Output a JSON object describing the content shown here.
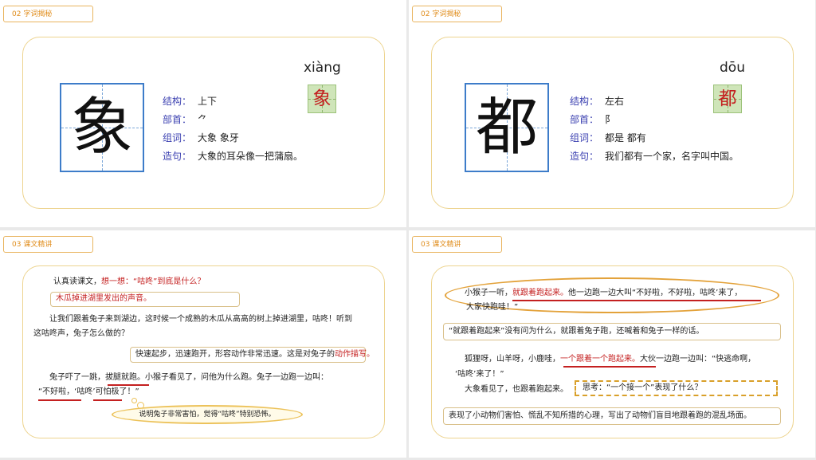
{
  "slides": [
    {
      "tag": "02  字词揭秘",
      "character": "象",
      "pinyin": "xiàng",
      "rows": [
        {
          "k": "结构：",
          "v": "上下"
        },
        {
          "k": "部首：",
          "v": "⺈"
        },
        {
          "k": "组词：",
          "v": "大象   象牙"
        },
        {
          "k": "造句：",
          "v": "大象的耳朵像一把蒲扇。"
        }
      ]
    },
    {
      "tag": "02  字词揭秘",
      "character": "都",
      "pinyin": "dōu",
      "rows": [
        {
          "k": "结构：",
          "v": "左右"
        },
        {
          "k": "部首：",
          "v": "阝"
        },
        {
          "k": "组词：",
          "v": "都是   都有"
        },
        {
          "k": "造句：",
          "v": "我们都有一个家，名字叫中国。"
        }
      ]
    },
    {
      "tag": "03  课文精讲",
      "l1a": "认真读课文，",
      "l1b": "想一想：“咕咚”到底是什么？",
      "answer": "木瓜掉进湖里发出的声音。",
      "p1": "让我们跟着兔子来到湖边，这时候一个成熟的木瓜从高高的树上掉进湖里，咕咚！听到",
      "p2": "这咕咚声，兔子怎么做的？",
      "note1a": "快速起步，迅速跑开，形容动作非常迅速。这是对兔子的",
      "note1b": "动作描写。",
      "q1a": "兔子吓了一跳，",
      "q1b": "拔腿就跑。",
      "q1c": "小猴子看见了，问他为什么跑。兔子一边跑一边叫：",
      "q2": "“不好啦，‘咕咚’可怕极了！”",
      "cloud": "说明兔子非常害怕，觉得“咕咚”特别恐怖。"
    },
    {
      "tag": "03  课文精讲",
      "a1": "小猴子一听，",
      "a1r": "就跟着跑起来。",
      "a1c": "他一边跑一边大叫“不好啦，不好啦，咕咚’来了，",
      "a2": "大家快跑哇！”",
      "b1": "“就跟着跑起来”没有问为什么，就跟着兔子跑，还喊着和兔子一样的话。",
      "c1a": "狐狸呀，山羊呀，小鹿哇，",
      "c1r": "一个跟着一个跑起来。",
      "c1c": "大伙一边跑一边叫：“快逃命啊，",
      "c2": "‘咕咚’来了！”",
      "c3": "大象看见了，也跟着跑起来。",
      "think": "思考：“一个接一个”表现了什么？",
      "d1": "表现了小动物们害怕、慌乱不知所措的心理，写出了动物们盲目地跟着跑的混乱场面。"
    }
  ]
}
